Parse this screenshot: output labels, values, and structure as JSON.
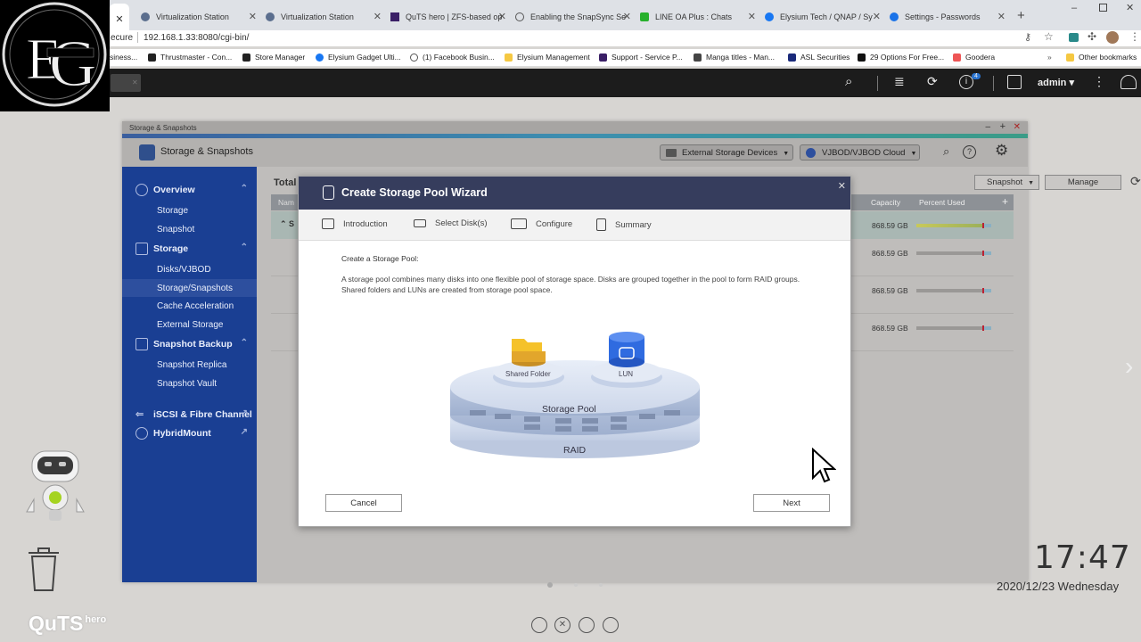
{
  "browser": {
    "tabs": [
      {
        "title": "Virtualization Station"
      },
      {
        "title": "Virtualization Station"
      },
      {
        "title": "QuTS hero | ZFS-based op"
      },
      {
        "title": "Enabling the SnapSync Se"
      },
      {
        "title": "LINE OA Plus : Chats"
      },
      {
        "title": "Elysium Tech / QNAP / Sy"
      },
      {
        "title": "Settings - Passwords"
      }
    ],
    "address_prefix": "ecure",
    "address": "192.168.1.33:8080/cgi-bin/",
    "bookmarks": [
      "siness...",
      "Thrustmaster - Con...",
      "Store Manager",
      "Elysium Gadget Ulti...",
      "(1) Facebook Busin...",
      "Elysium Management",
      "Support - Service P...",
      "Manga titles - Man...",
      "ASL Securities",
      "29 Options For Free...",
      "Goodera"
    ],
    "other_bookmarks": "Other bookmarks",
    "more_bookmarks": "»"
  },
  "nas_topbar": {
    "user": "admin ▾",
    "notification_count": "4"
  },
  "app": {
    "window_title": "Storage & Snapshots",
    "title": "Storage & Snapshots",
    "external_storage": "External Storage Devices",
    "vjbod_cloud": "VJBOD/VJBOD Cloud",
    "snapshot_btn": "Snapshot",
    "manage_btn": "Manage",
    "total_label": "Total",
    "col_name": "Nam",
    "col_capacity": "Capacity",
    "col_percent": "Percent Used",
    "row_s": "S",
    "rows": [
      {
        "capacity": "868.59 GB",
        "used": 0.88
      },
      {
        "capacity": "868.59 GB",
        "used": 0.88
      },
      {
        "capacity": "868.59 GB",
        "used": 0.88
      },
      {
        "capacity": "868.59 GB",
        "used": 0.88
      }
    ],
    "sidebar": {
      "overview": "Overview",
      "storage_sub": "Storage",
      "snapshot_sub": "Snapshot",
      "storage": "Storage",
      "disks": "Disks/VJBOD",
      "storage_snapshots": "Storage/Snapshots",
      "cache": "Cache Acceleration",
      "external": "External Storage",
      "snapshot_backup": "Snapshot Backup",
      "snapshot_replica": "Snapshot Replica",
      "snapshot_vault": "Snapshot Vault",
      "iscsi": "iSCSI & Fibre Channel",
      "hybridmount": "HybridMount"
    }
  },
  "wizard": {
    "title": "Create Storage Pool Wizard",
    "steps": [
      "Introduction",
      "Select Disk(s)",
      "Configure",
      "Summary"
    ],
    "heading": "Create a Storage Pool:",
    "description": "A storage pool combines many disks into one flexible pool of storage space. Disks are grouped together in the pool to form RAID groups. Shared folders and LUNs are created from storage pool space.",
    "diagram": {
      "shared_folder": "Shared Folder",
      "lun": "LUN",
      "storage_pool": "Storage Pool",
      "raid": "RAID"
    },
    "cancel": "Cancel",
    "next": "Next"
  },
  "desktop": {
    "time": "17:47",
    "date": "2020/12/23 Wednesday",
    "brand": "QuTS",
    "brand_sup": "hero"
  }
}
